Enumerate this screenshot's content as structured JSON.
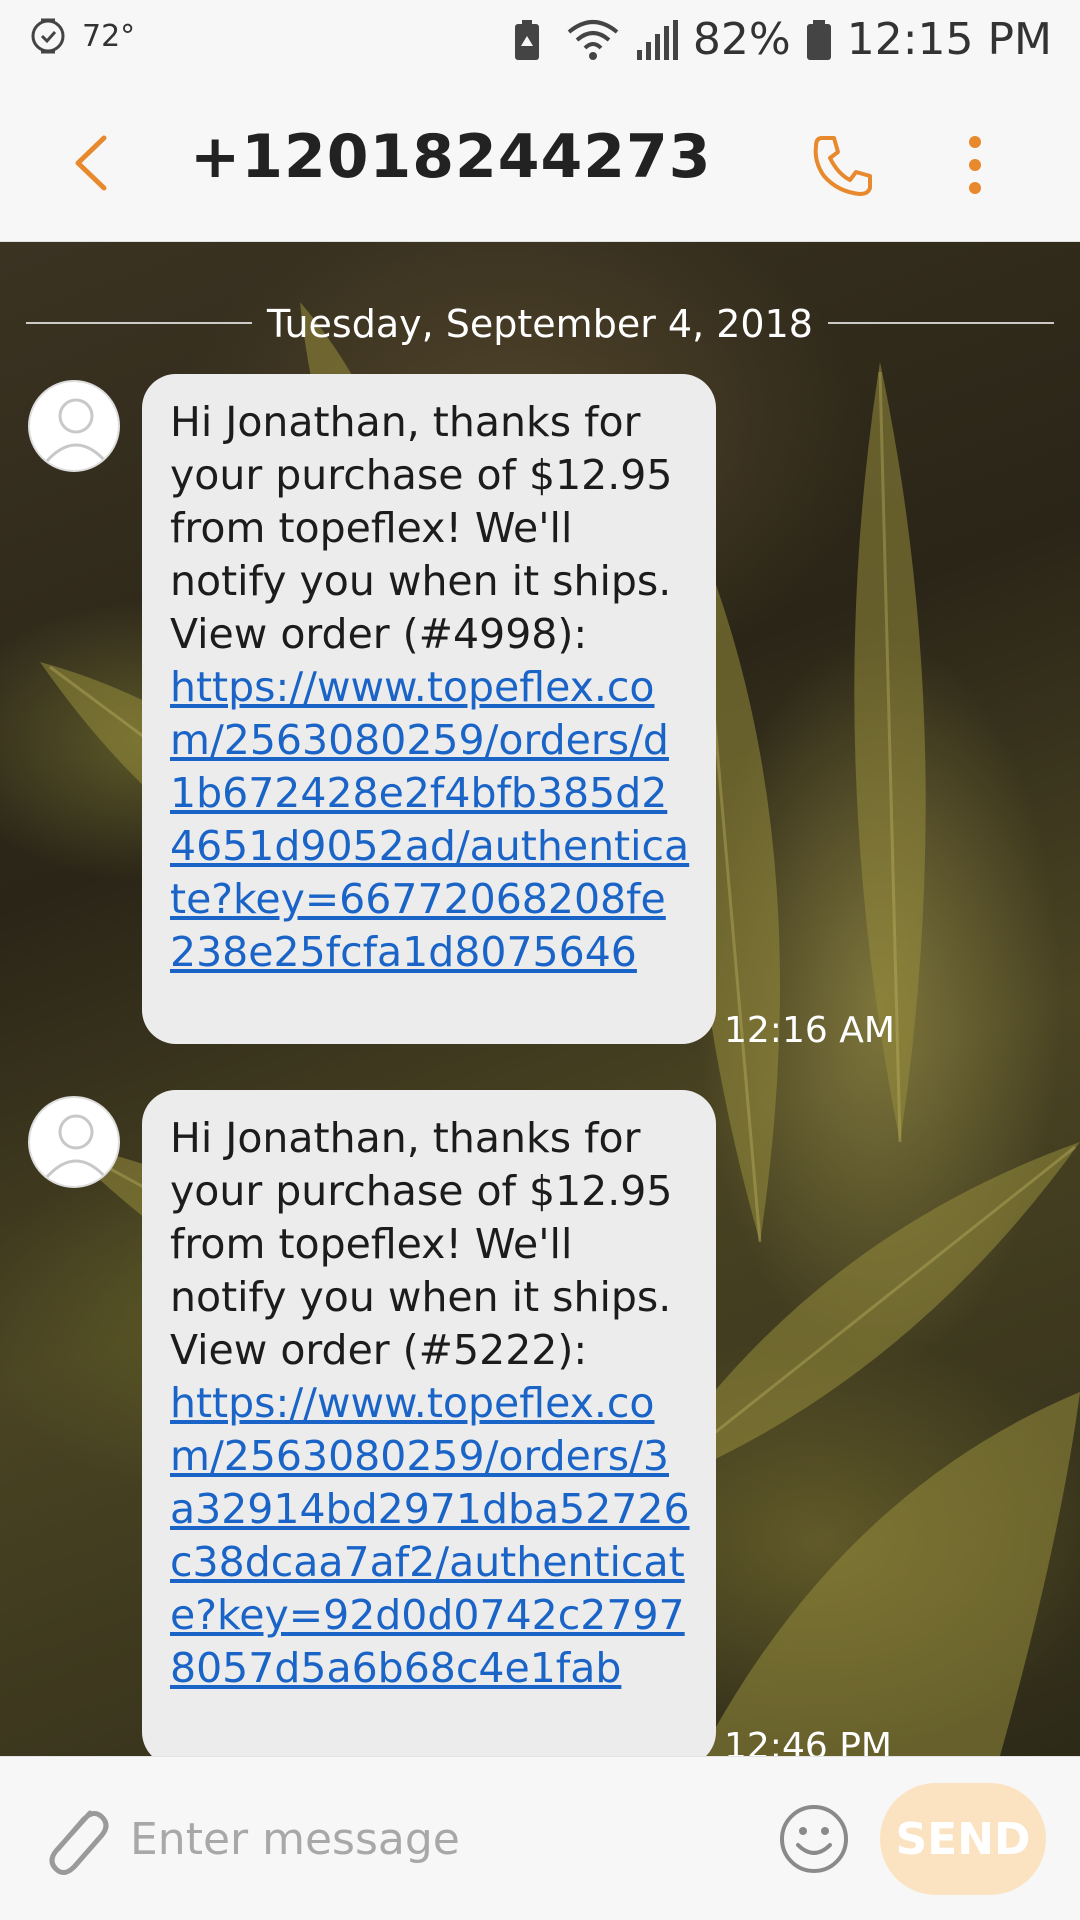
{
  "status_bar": {
    "temperature": "72°",
    "battery_percent": "82%",
    "time": "12:15 PM"
  },
  "header": {
    "title": "+12018244273"
  },
  "conversation": {
    "date_divider": "Tuesday, September 4, 2018",
    "messages": [
      {
        "text": "Hi Jonathan, thanks for your purchase of $12.95 from topeflex! We'll notify you when it ships. View order (#4998):",
        "link": "https://www.topeflex.com/2563080259/orders/d1b672428e2f4bfb385d24651d9052ad/authenticate?key=66772068208fe238e25fcfa1d8075646",
        "time": "12:16 AM"
      },
      {
        "text": "Hi Jonathan, thanks for your purchase of $12.95 from topeflex! We'll notify you when it ships. View order (#5222):",
        "link": "https://www.topeflex.com/2563080259/orders/3a32914bd2971dba52726c38dcaa7af2/authenticate?key=92d0d0742c27978057d5a6b68c4e1fab",
        "time": "12:46 PM"
      }
    ]
  },
  "composer": {
    "placeholder": "Enter message",
    "send_label": "SEND"
  },
  "colors": {
    "accent": "#e8892e",
    "link": "#1a64c8",
    "bubble": "#ececec",
    "send_disabled": "#fbe3c2"
  }
}
